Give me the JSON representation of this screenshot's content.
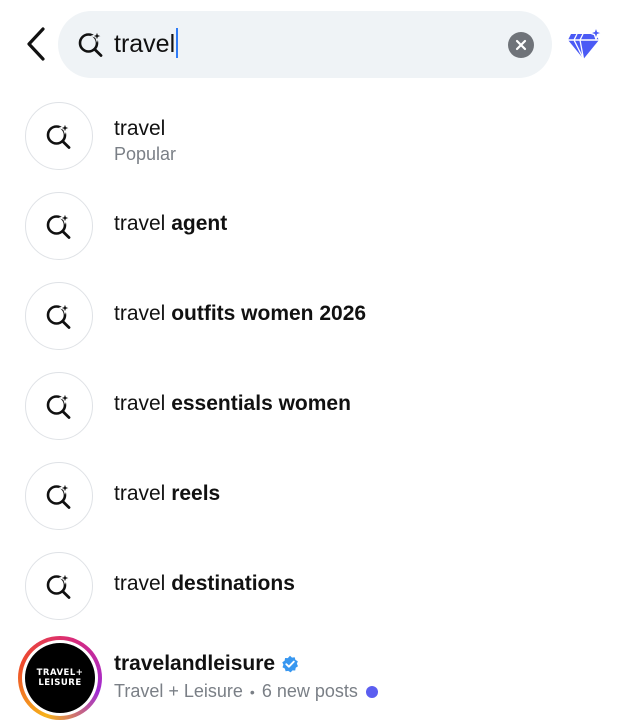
{
  "search": {
    "query": "travel",
    "icons": {
      "back": "chevron-left-icon",
      "search": "search-sparkle-icon",
      "clear": "clear-x-icon",
      "ai": "ai-sparkle-icon"
    }
  },
  "suggestions": [
    {
      "prefix": "travel",
      "suffix": "",
      "subtitle": "Popular"
    },
    {
      "prefix": "travel ",
      "suffix": "agent",
      "subtitle": ""
    },
    {
      "prefix": "travel ",
      "suffix": "outfits women 2026",
      "subtitle": ""
    },
    {
      "prefix": "travel ",
      "suffix": "essentials women",
      "subtitle": ""
    },
    {
      "prefix": "travel ",
      "suffix": "reels",
      "subtitle": ""
    },
    {
      "prefix": "travel ",
      "suffix": "destinations",
      "subtitle": ""
    }
  ],
  "account": {
    "username": "travelandleisure",
    "display_name": "Travel + Leisure",
    "separator": "•",
    "new_posts": "6 new posts",
    "avatar_text_line1": "TRAVEL+",
    "avatar_text_line2": "LEISURE",
    "verified": true
  },
  "colors": {
    "caret": "#2f7bf6",
    "verified_badge": "#3897f0",
    "new_post_dot": "#5b5ef0",
    "ai_icon": "#4a5af5"
  }
}
